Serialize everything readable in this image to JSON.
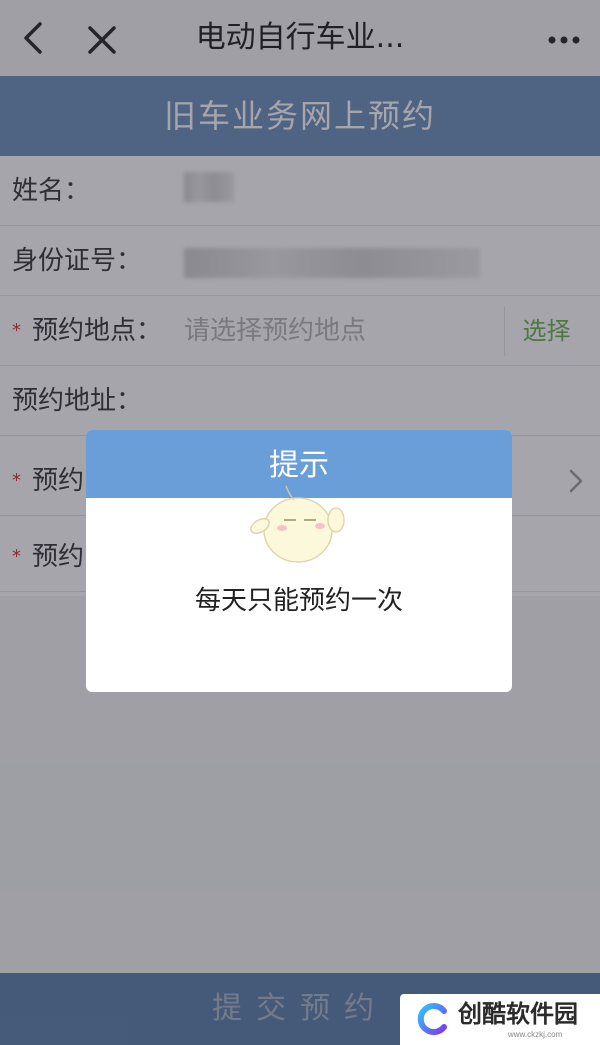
{
  "topbar": {
    "title": "电动自行车业..."
  },
  "header": {
    "title": "旧车业务网上预约"
  },
  "form": {
    "name_label": "姓名：",
    "id_label": "身份证号：",
    "location_label": "预约地点：",
    "location_placeholder": "请选择预约地点",
    "location_select": "选择",
    "address_label": "预约地址：",
    "row5_label": "预约",
    "row6_label": "预约",
    "required_mark": "*"
  },
  "dialog": {
    "title": "提示",
    "message": "每天只能预约一次"
  },
  "submit": {
    "label": "提交预约"
  },
  "watermark": {
    "name": "创酷软件园",
    "url": "www.ckzkj.com"
  },
  "colors": {
    "header": "#6a8fb8",
    "dialog_header": "#6a9ed9",
    "select": "#6ab04c",
    "submit": "#5b7fa8"
  }
}
